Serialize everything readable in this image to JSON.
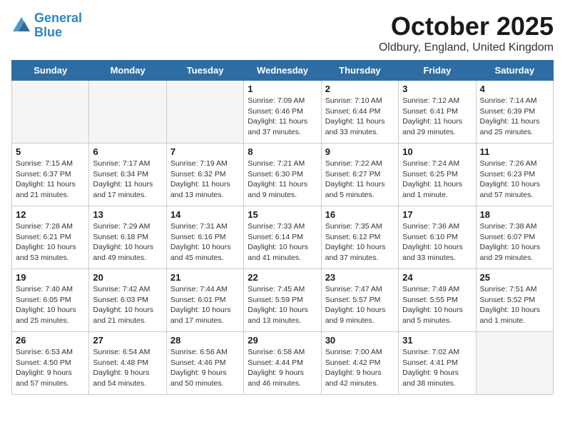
{
  "header": {
    "logo_line1": "General",
    "logo_line2": "Blue",
    "month_title": "October 2025",
    "location": "Oldbury, England, United Kingdom"
  },
  "days_of_week": [
    "Sunday",
    "Monday",
    "Tuesday",
    "Wednesday",
    "Thursday",
    "Friday",
    "Saturday"
  ],
  "weeks": [
    [
      {
        "num": "",
        "info": "",
        "empty": true
      },
      {
        "num": "",
        "info": "",
        "empty": true
      },
      {
        "num": "",
        "info": "",
        "empty": true
      },
      {
        "num": "1",
        "info": "Sunrise: 7:09 AM\nSunset: 6:46 PM\nDaylight: 11 hours\nand 37 minutes.",
        "empty": false
      },
      {
        "num": "2",
        "info": "Sunrise: 7:10 AM\nSunset: 6:44 PM\nDaylight: 11 hours\nand 33 minutes.",
        "empty": false
      },
      {
        "num": "3",
        "info": "Sunrise: 7:12 AM\nSunset: 6:41 PM\nDaylight: 11 hours\nand 29 minutes.",
        "empty": false
      },
      {
        "num": "4",
        "info": "Sunrise: 7:14 AM\nSunset: 6:39 PM\nDaylight: 11 hours\nand 25 minutes.",
        "empty": false
      }
    ],
    [
      {
        "num": "5",
        "info": "Sunrise: 7:15 AM\nSunset: 6:37 PM\nDaylight: 11 hours\nand 21 minutes.",
        "empty": false
      },
      {
        "num": "6",
        "info": "Sunrise: 7:17 AM\nSunset: 6:34 PM\nDaylight: 11 hours\nand 17 minutes.",
        "empty": false
      },
      {
        "num": "7",
        "info": "Sunrise: 7:19 AM\nSunset: 6:32 PM\nDaylight: 11 hours\nand 13 minutes.",
        "empty": false
      },
      {
        "num": "8",
        "info": "Sunrise: 7:21 AM\nSunset: 6:30 PM\nDaylight: 11 hours\nand 9 minutes.",
        "empty": false
      },
      {
        "num": "9",
        "info": "Sunrise: 7:22 AM\nSunset: 6:27 PM\nDaylight: 11 hours\nand 5 minutes.",
        "empty": false
      },
      {
        "num": "10",
        "info": "Sunrise: 7:24 AM\nSunset: 6:25 PM\nDaylight: 11 hours\nand 1 minute.",
        "empty": false
      },
      {
        "num": "11",
        "info": "Sunrise: 7:26 AM\nSunset: 6:23 PM\nDaylight: 10 hours\nand 57 minutes.",
        "empty": false
      }
    ],
    [
      {
        "num": "12",
        "info": "Sunrise: 7:28 AM\nSunset: 6:21 PM\nDaylight: 10 hours\nand 53 minutes.",
        "empty": false
      },
      {
        "num": "13",
        "info": "Sunrise: 7:29 AM\nSunset: 6:18 PM\nDaylight: 10 hours\nand 49 minutes.",
        "empty": false
      },
      {
        "num": "14",
        "info": "Sunrise: 7:31 AM\nSunset: 6:16 PM\nDaylight: 10 hours\nand 45 minutes.",
        "empty": false
      },
      {
        "num": "15",
        "info": "Sunrise: 7:33 AM\nSunset: 6:14 PM\nDaylight: 10 hours\nand 41 minutes.",
        "empty": false
      },
      {
        "num": "16",
        "info": "Sunrise: 7:35 AM\nSunset: 6:12 PM\nDaylight: 10 hours\nand 37 minutes.",
        "empty": false
      },
      {
        "num": "17",
        "info": "Sunrise: 7:36 AM\nSunset: 6:10 PM\nDaylight: 10 hours\nand 33 minutes.",
        "empty": false
      },
      {
        "num": "18",
        "info": "Sunrise: 7:38 AM\nSunset: 6:07 PM\nDaylight: 10 hours\nand 29 minutes.",
        "empty": false
      }
    ],
    [
      {
        "num": "19",
        "info": "Sunrise: 7:40 AM\nSunset: 6:05 PM\nDaylight: 10 hours\nand 25 minutes.",
        "empty": false
      },
      {
        "num": "20",
        "info": "Sunrise: 7:42 AM\nSunset: 6:03 PM\nDaylight: 10 hours\nand 21 minutes.",
        "empty": false
      },
      {
        "num": "21",
        "info": "Sunrise: 7:44 AM\nSunset: 6:01 PM\nDaylight: 10 hours\nand 17 minutes.",
        "empty": false
      },
      {
        "num": "22",
        "info": "Sunrise: 7:45 AM\nSunset: 5:59 PM\nDaylight: 10 hours\nand 13 minutes.",
        "empty": false
      },
      {
        "num": "23",
        "info": "Sunrise: 7:47 AM\nSunset: 5:57 PM\nDaylight: 10 hours\nand 9 minutes.",
        "empty": false
      },
      {
        "num": "24",
        "info": "Sunrise: 7:49 AM\nSunset: 5:55 PM\nDaylight: 10 hours\nand 5 minutes.",
        "empty": false
      },
      {
        "num": "25",
        "info": "Sunrise: 7:51 AM\nSunset: 5:52 PM\nDaylight: 10 hours\nand 1 minute.",
        "empty": false
      }
    ],
    [
      {
        "num": "26",
        "info": "Sunrise: 6:53 AM\nSunset: 4:50 PM\nDaylight: 9 hours\nand 57 minutes.",
        "empty": false
      },
      {
        "num": "27",
        "info": "Sunrise: 6:54 AM\nSunset: 4:48 PM\nDaylight: 9 hours\nand 54 minutes.",
        "empty": false
      },
      {
        "num": "28",
        "info": "Sunrise: 6:56 AM\nSunset: 4:46 PM\nDaylight: 9 hours\nand 50 minutes.",
        "empty": false
      },
      {
        "num": "29",
        "info": "Sunrise: 6:58 AM\nSunset: 4:44 PM\nDaylight: 9 hours\nand 46 minutes.",
        "empty": false
      },
      {
        "num": "30",
        "info": "Sunrise: 7:00 AM\nSunset: 4:42 PM\nDaylight: 9 hours\nand 42 minutes.",
        "empty": false
      },
      {
        "num": "31",
        "info": "Sunrise: 7:02 AM\nSunset: 4:41 PM\nDaylight: 9 hours\nand 38 minutes.",
        "empty": false
      },
      {
        "num": "",
        "info": "",
        "empty": true
      }
    ]
  ]
}
